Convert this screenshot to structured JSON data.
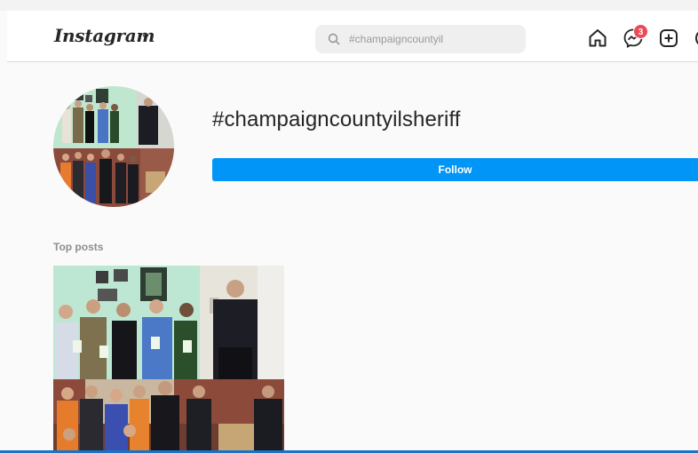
{
  "header": {
    "logo_text": "Instagram",
    "search": {
      "placeholder": "#champaigncountyil",
      "value": ""
    },
    "icons": [
      "home-icon",
      "messenger-icon",
      "new-post-icon"
    ],
    "messenger_badge": "3",
    "colors": {
      "badge": "#ed4956"
    }
  },
  "profile": {
    "hashtag": "#champaigncountyilsheriff",
    "follow_label": "Follow",
    "colors": {
      "follow_button": "#0095f6"
    }
  },
  "posts": {
    "section_label": "Top posts"
  }
}
